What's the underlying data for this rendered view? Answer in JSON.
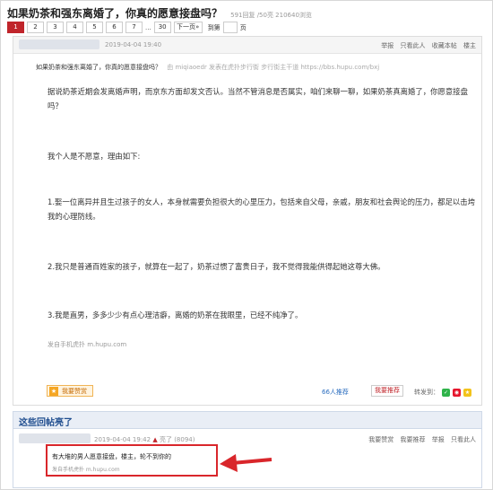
{
  "header": {
    "title": "如果奶茶和强东离婚了，你真的愿意接盘吗？",
    "stats": "591回复 /50亮  210640浏览"
  },
  "pager": {
    "pages": [
      "1",
      "2",
      "3",
      "4",
      "5",
      "6",
      "7"
    ],
    "ellipsis": "...",
    "last": "30",
    "next_label": "下一页»",
    "goto_label": "到第",
    "page_suffix": "页"
  },
  "post": {
    "author_nickname": "",
    "time": "2019-04-04 19:40",
    "actions": [
      "举报",
      "只看此人",
      "收藏本帖",
      "楼主"
    ],
    "quote_title": "如果奶茶和强东离婚了，你真的愿意接盘吗？",
    "quote_source": "由  miqiaoedr 发表在虎扑步行街  步行街主干道 https://bbs.hupu.com/bxj",
    "paragraphs": [
      "据说奶茶近期会发离婚声明，而京东方面却发文否认。当然不管消息是否属实，咱们来聊一聊，如果奶茶真离婚了，你愿意接盘吗？",
      "我个人是不愿意，理由如下:",
      "1.娶一位离异并且生过孩子的女人，本身就需要负担很大的心里压力，包括来自父母，亲戚，朋友和社会舆论的压力，都足以击垮我的心理防线。",
      "2.我只是普通百姓家的孩子，就算在一起了，奶茶过惯了富贵日子，我不觉得我能供得起她这尊大佛。",
      "3.我是直男，多多少少有点心理洁癖，离婚的奶茶在我眼里，已经不纯净了。"
    ],
    "mobile_note": "发自手机虎扑 m.hupu.com",
    "like_button": "我要赞赏",
    "recommend_count": "66人推荐",
    "recommend_button": "我要推荐",
    "share_label": "转发到："
  },
  "hot_replies": {
    "title": "这些回帖亮了",
    "reply": {
      "time": "2019-04-04 19:42",
      "light_label": "亮了",
      "light_count": "(8094)",
      "actions": [
        "我要赞赏",
        "我要推荐",
        "举报",
        "只看此人"
      ],
      "text": "有大堆的男人愿意接盘，楼主，轮不到你的",
      "source": "发自手机虎扑 m.hupu.com"
    }
  },
  "icons": {
    "like": "thumb-up-icon",
    "share": [
      "wechat-icon",
      "weibo-icon",
      "qzone-icon"
    ],
    "arrow": "red-arrow-icon"
  },
  "colors": {
    "current_page": "#c0252b",
    "hot_title": "#1f4d8f",
    "highlight_box": "#d9262b"
  }
}
